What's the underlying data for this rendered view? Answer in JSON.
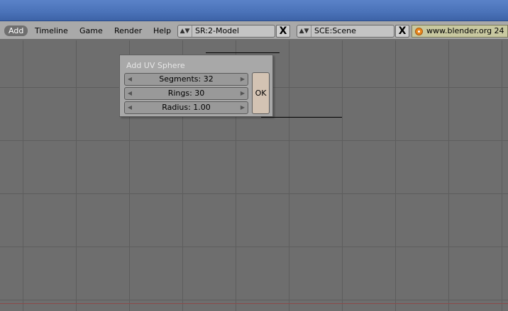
{
  "header": {
    "menu": [
      "Add",
      "Timeline",
      "Game",
      "Render",
      "Help"
    ],
    "screen_field": "SR:2-Model",
    "scene_field": "SCE:Scene",
    "close_label": "X",
    "link_text": "www.blender.org 24"
  },
  "dialog": {
    "title": "Add UV Sphere",
    "segments": "Segments: 32",
    "rings": "Rings: 30",
    "radius": "Radius: 1.00",
    "ok_label": "OK"
  },
  "colors": {
    "title_bar": "#4a72b8",
    "header_bg": "#a9a9a9",
    "viewport_bg": "#6e6e6e",
    "ok_button": "#d3c3b3"
  }
}
